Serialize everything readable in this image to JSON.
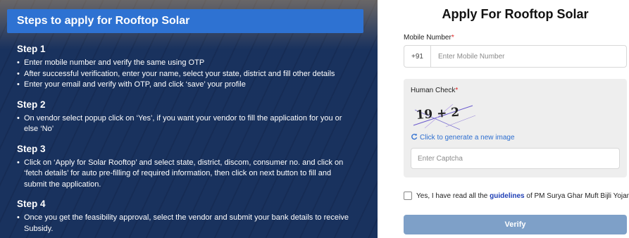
{
  "steps_panel": {
    "header": "Steps to apply for Rooftop Solar",
    "steps": [
      {
        "title": "Step 1",
        "items": [
          "Enter mobile number and verify the same using OTP",
          "After successful verification, enter your name, select your state, district and fill other details",
          "Enter your email and verify with OTP, and click ‘save’ your profile"
        ]
      },
      {
        "title": "Step 2",
        "items": [
          "On vendor select popup click on ‘Yes’, if you want your vendor to fill the application for you or else ‘No’"
        ]
      },
      {
        "title": "Step 3",
        "items": [
          "Click on ‘Apply for Solar Rooftop’ and select state, district, discom, consumer no. and click on ‘fetch details’ for auto pre-filling of required information, then click on next button to fill and submit the application."
        ]
      },
      {
        "title": "Step 4",
        "items": [
          "Once you get the feasibility approval, select the vendor and submit your bank details to receive Subsidy."
        ]
      }
    ]
  },
  "form": {
    "title": "Apply For Rooftop Solar",
    "mobile": {
      "label": "Mobile Number",
      "required_mark": "*",
      "prefix": "+91",
      "placeholder": "Enter Mobile Number",
      "value": ""
    },
    "human_check": {
      "label": "Human Check",
      "required_mark": "*",
      "captcha_text": "19 + 2",
      "refresh_label": "Click to generate a new image",
      "captcha_placeholder": "Enter Captcha"
    },
    "consent": {
      "prefix_text": "Yes, I have read all the ",
      "link_text": "guidelines",
      "suffix_text": " of PM Surya Ghar Muft Bijli Yojana.",
      "checked": false
    },
    "verify_label": "Verify"
  },
  "colors": {
    "header_blue": "#2e72d2",
    "link_blue": "#2e6fd0",
    "guidelines_blue": "#1f3fb5",
    "verify_button": "#7ea0c8",
    "required_red": "#d22"
  },
  "icons": {
    "refresh": "refresh-icon"
  }
}
